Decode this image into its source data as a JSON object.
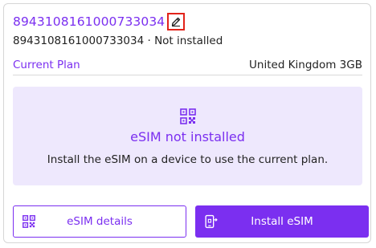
{
  "card": {
    "iccid_title": "8943108161000733034",
    "edit_icon": "edit-pencil-icon",
    "subline": "8943108161000733034 · Not installed"
  },
  "plan": {
    "label": "Current Plan",
    "value": "United Kingdom 3GB"
  },
  "status": {
    "icon": "qr-code-icon",
    "title": "eSIM not installed",
    "description": "Install the eSIM on a device to use the current plan."
  },
  "actions": {
    "details_label": "eSIM details",
    "details_icon": "qr-code-icon",
    "install_label": "Install eSIM",
    "install_icon": "phone-install-icon"
  },
  "colors": {
    "accent": "#7b2ff0",
    "status_bg": "#eee8fd",
    "highlight_border": "#e2231a"
  }
}
